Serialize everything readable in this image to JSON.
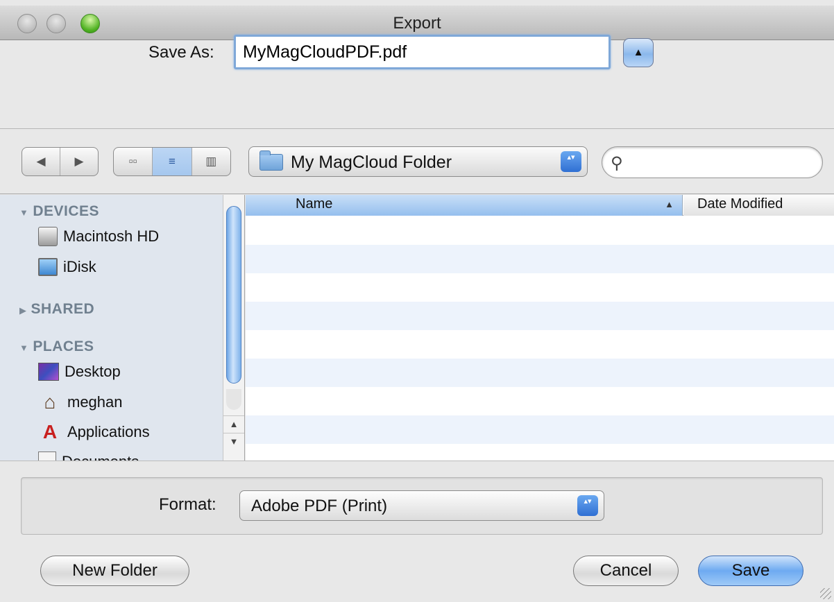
{
  "window": {
    "title": "Export"
  },
  "save_as": {
    "label": "Save As:",
    "value": "MyMagCloudPDF.pdf",
    "expand_icon": "triangle-up-icon",
    "expand_glyph": "▲"
  },
  "toolbar": {
    "back_glyph": "◀",
    "forward_glyph": "▶",
    "views": [
      {
        "name": "icon-view",
        "glyph": "▫▫",
        "active": false
      },
      {
        "name": "list-view",
        "glyph": "≡",
        "active": true
      },
      {
        "name": "column-view",
        "glyph": "▥",
        "active": false
      }
    ],
    "location": "My MagCloud Folder",
    "search_placeholder": "",
    "search_glyph": "🔍"
  },
  "sidebar": {
    "sections": [
      {
        "label": "DEVICES",
        "expanded": true
      },
      {
        "label": "SHARED",
        "expanded": false
      },
      {
        "label": "PLACES",
        "expanded": true
      }
    ],
    "items": [
      {
        "label": "Macintosh HD",
        "icon": "hard-drive-icon"
      },
      {
        "label": "iDisk",
        "icon": "idisk-icon"
      },
      {
        "label": "Desktop",
        "icon": "desktop-icon"
      },
      {
        "label": "meghan",
        "icon": "home-icon"
      },
      {
        "label": "Applications",
        "icon": "applications-icon"
      },
      {
        "label": "Documents",
        "icon": "documents-icon"
      }
    ],
    "scroll_up_glyph": "▲",
    "scroll_down_glyph": "▼"
  },
  "filelist": {
    "columns": [
      {
        "label": "Name",
        "sorted": true,
        "sort_glyph": "▲"
      },
      {
        "label": "Date Modified",
        "sorted": false
      }
    ],
    "rows": []
  },
  "format": {
    "label": "Format:",
    "value": "Adobe PDF (Print)"
  },
  "popup_arrow_glyph": "▴▾",
  "buttons": {
    "new_folder": "New Folder",
    "cancel": "Cancel",
    "save": "Save"
  },
  "colors": {
    "accent": "#6eaaf1",
    "selection": "#95bfee",
    "sidebar_bg": "#e0e6ee",
    "row_alt": "#edf3fc"
  }
}
